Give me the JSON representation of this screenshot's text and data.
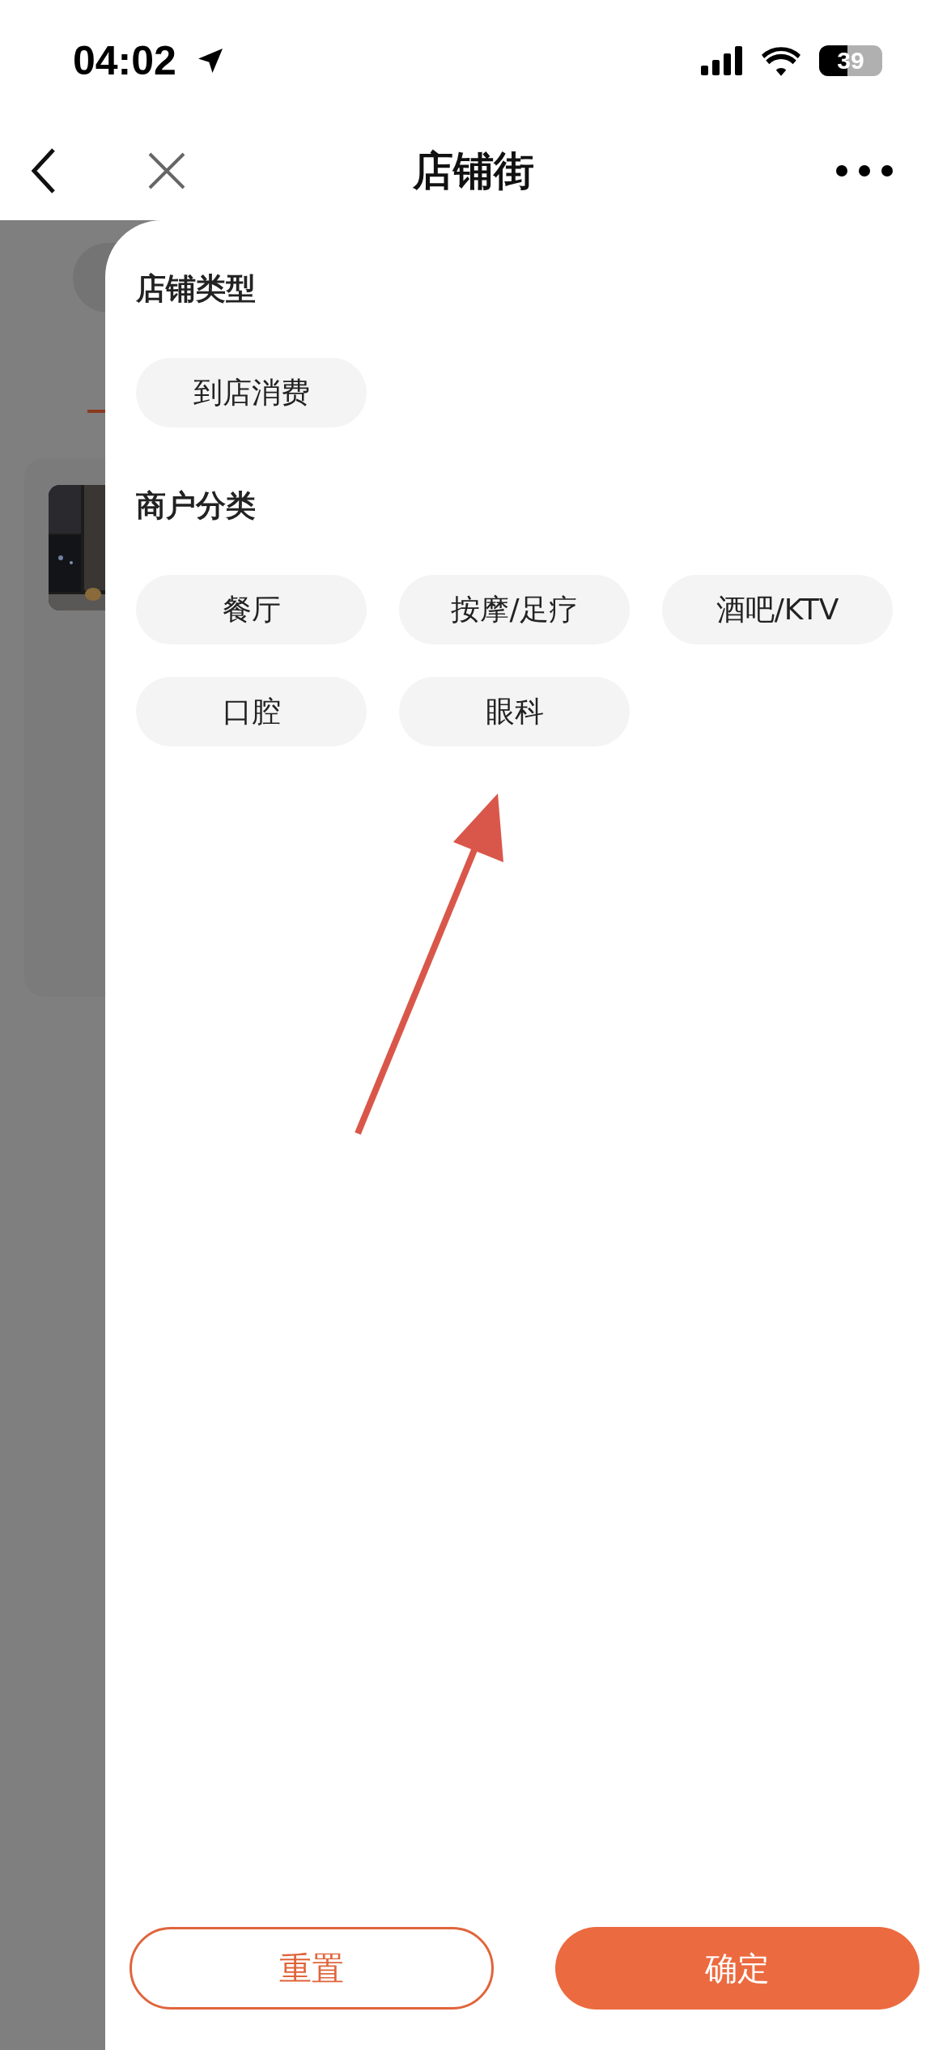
{
  "status_bar": {
    "time": "04:02",
    "battery": "39"
  },
  "nav": {
    "title": "店铺街"
  },
  "sections": [
    {
      "title": "店铺类型",
      "chips": [
        {
          "label": "到店消费",
          "selected": false
        }
      ]
    },
    {
      "title": "商户分类",
      "chips": [
        {
          "label": "餐厅",
          "selected": false
        },
        {
          "label": "按摩/足疗",
          "selected": false
        },
        {
          "label": "酒吧/KTV",
          "selected": false
        },
        {
          "label": "口腔",
          "selected": false
        },
        {
          "label": "眼科",
          "selected": false
        }
      ]
    }
  ],
  "buttons": [
    {
      "label": "重置",
      "kind": "outline"
    },
    {
      "label": "确定",
      "kind": "primary"
    }
  ]
}
